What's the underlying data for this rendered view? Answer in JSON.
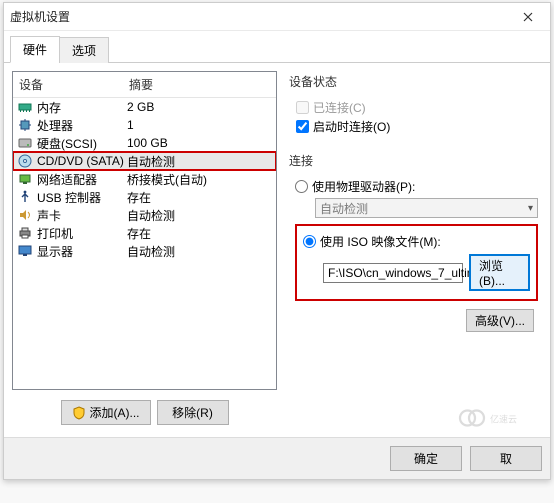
{
  "window": {
    "title": "虚拟机设置"
  },
  "tabs": {
    "hardware": "硬件",
    "options": "选项"
  },
  "hw_head": {
    "device": "设备",
    "summary": "摘要"
  },
  "hw": [
    {
      "icon": "memory-icon",
      "device": "内存",
      "summary": "2 GB"
    },
    {
      "icon": "cpu-icon",
      "device": "处理器",
      "summary": "1"
    },
    {
      "icon": "disk-icon",
      "device": "硬盘(SCSI)",
      "summary": "100 GB"
    },
    {
      "icon": "cd-icon",
      "device": "CD/DVD (SATA)",
      "summary": "自动检测"
    },
    {
      "icon": "nic-icon",
      "device": "网络适配器",
      "summary": "桥接模式(自动)"
    },
    {
      "icon": "usb-icon",
      "device": "USB 控制器",
      "summary": "存在"
    },
    {
      "icon": "sound-icon",
      "device": "声卡",
      "summary": "自动检测"
    },
    {
      "icon": "printer-icon",
      "device": "打印机",
      "summary": "存在"
    },
    {
      "icon": "monitor-icon",
      "device": "显示器",
      "summary": "自动检测"
    }
  ],
  "left_buttons": {
    "add": "添加(A)...",
    "remove": "移除(R)"
  },
  "right": {
    "status_title": "设备状态",
    "connected": "已连接(C)",
    "connect_at_power": "启动时连接(O)",
    "connection_title": "连接",
    "use_physical": "使用物理驱动器(P):",
    "physical_value": "自动检测",
    "use_iso": "使用 ISO 映像文件(M):",
    "iso_path": "F:\\ISO\\cn_windows_7_ultin",
    "browse": "浏览(B)...",
    "advanced": "高级(V)..."
  },
  "footer": {
    "ok": "确定",
    "cancel": "取"
  },
  "watermark": "亿速云"
}
